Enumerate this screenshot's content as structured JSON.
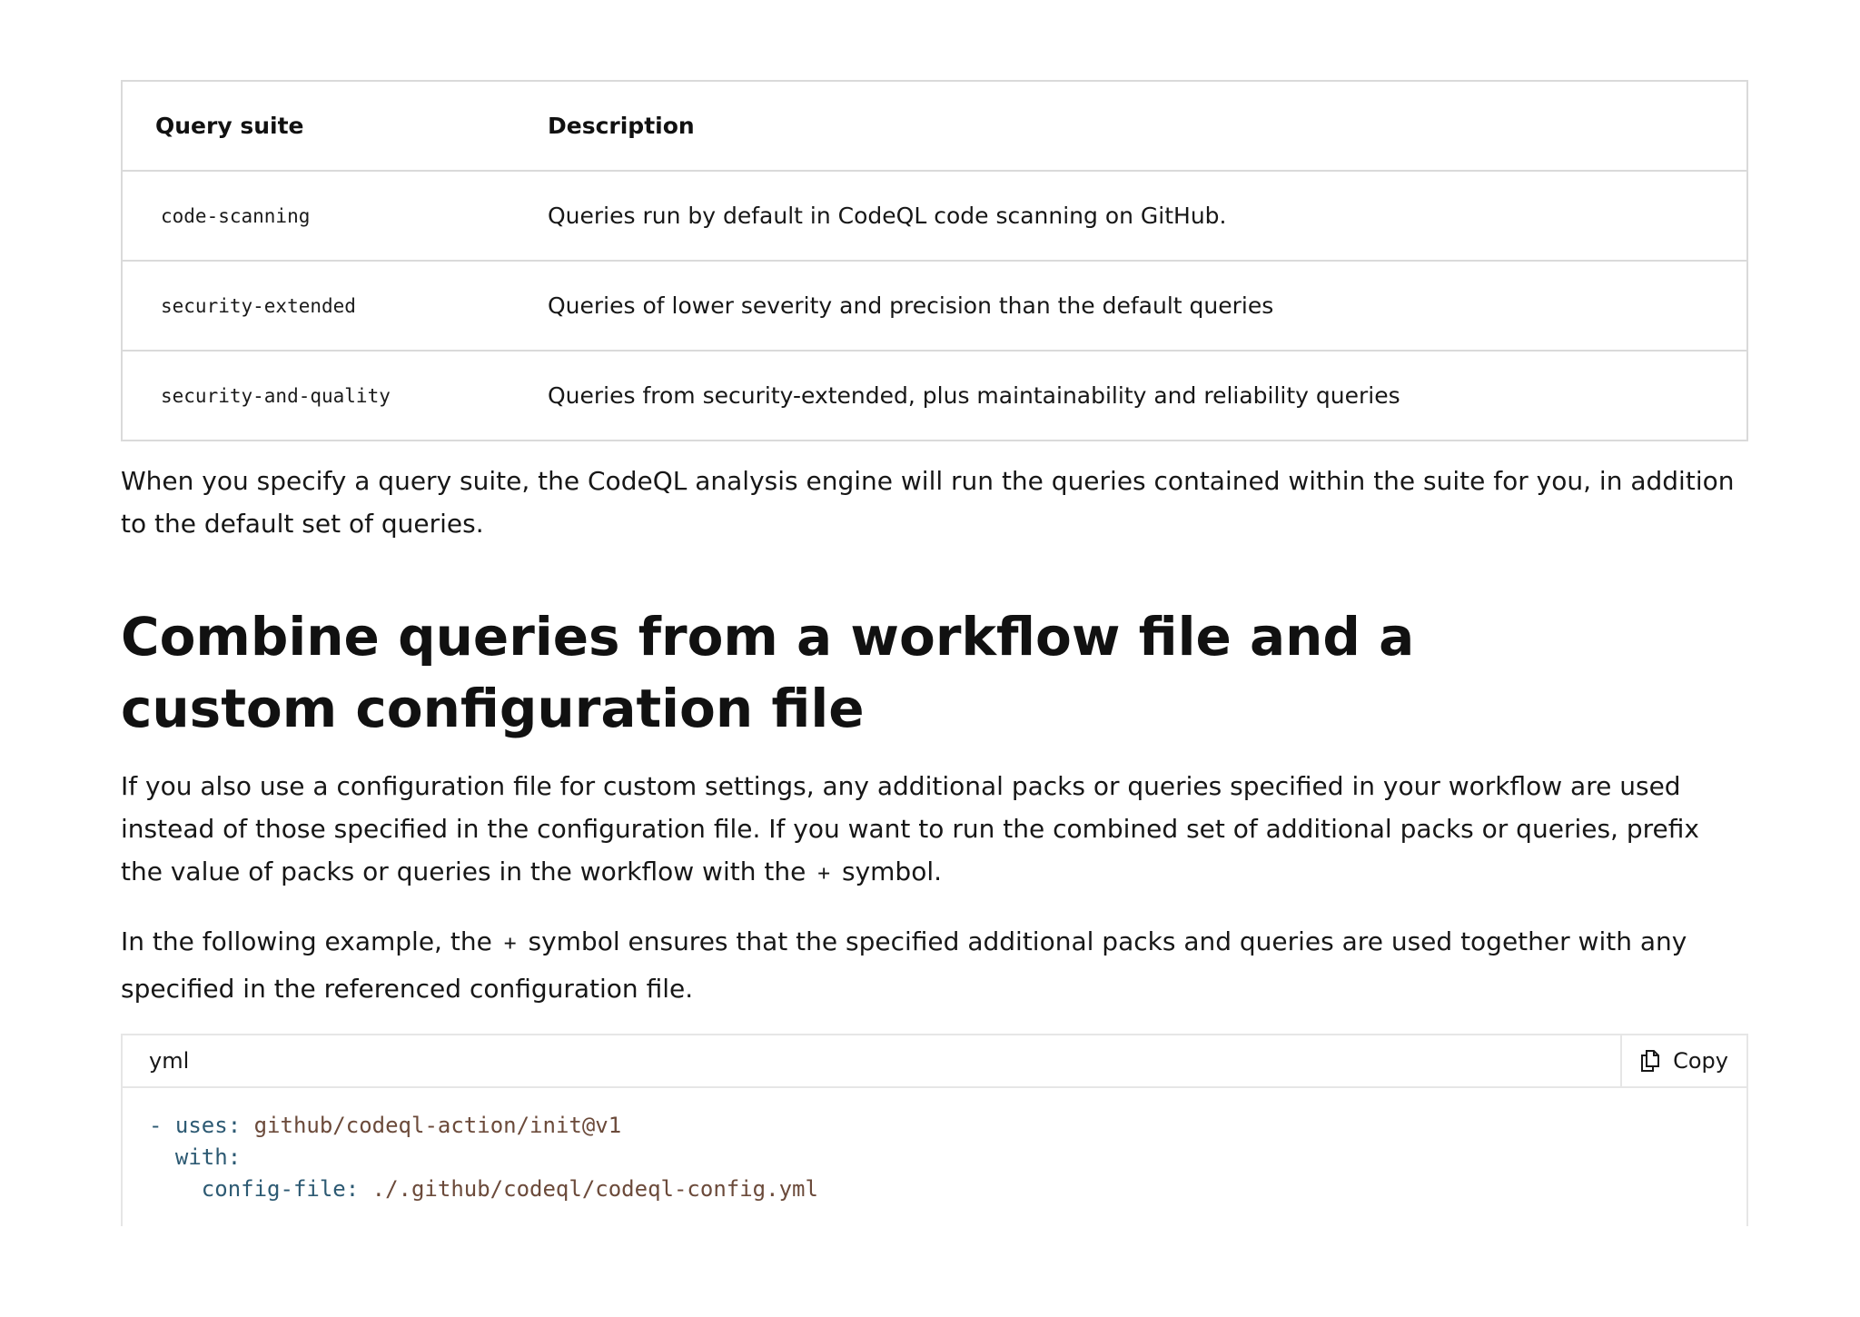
{
  "suites_table": {
    "headers": [
      "Query suite",
      "Description"
    ],
    "rows": [
      {
        "suite": "code-scanning",
        "description": "Queries run by default in CodeQL code scanning on GitHub."
      },
      {
        "suite": "security-extended",
        "description": "Queries of lower severity and precision than the default queries"
      },
      {
        "suite": "security-and-quality",
        "description": "Queries from security-extended, plus maintainability and reliability queries"
      }
    ]
  },
  "paragraph_suite": "When you specify a query suite, the CodeQL analysis engine will run the queries contained within the suite for you, in addition to the default set of queries.",
  "section": {
    "title": "Combine queries from a workflow file and a custom configuration file",
    "para1_before": "If you also use a configuration file for custom settings, any additional packs or queries specified in your workflow are used instead of those specified in the configuration file. If you want to run the combined set of additional packs or queries, prefix the value of packs or queries in the workflow with the",
    "para1_code": "+",
    "para1_after": "symbol.",
    "para2_before": "In the following example, the",
    "para2_code": "+",
    "para2_after": "symbol ensures that the specified additional packs and queries are used together with any specified in the referenced configuration file."
  },
  "code_block": {
    "language": "yml",
    "copy_label": "Copy",
    "lines": [
      {
        "indent": "",
        "prefix": "- ",
        "key": "uses:",
        "value": " github/codeql-action/init@v1"
      },
      {
        "indent": "  ",
        "prefix": "",
        "key": "with:",
        "value": ""
      },
      {
        "indent": "    ",
        "prefix": "",
        "key": "config-file:",
        "value": " ./.github/codeql/codeql-config.yml"
      }
    ]
  }
}
